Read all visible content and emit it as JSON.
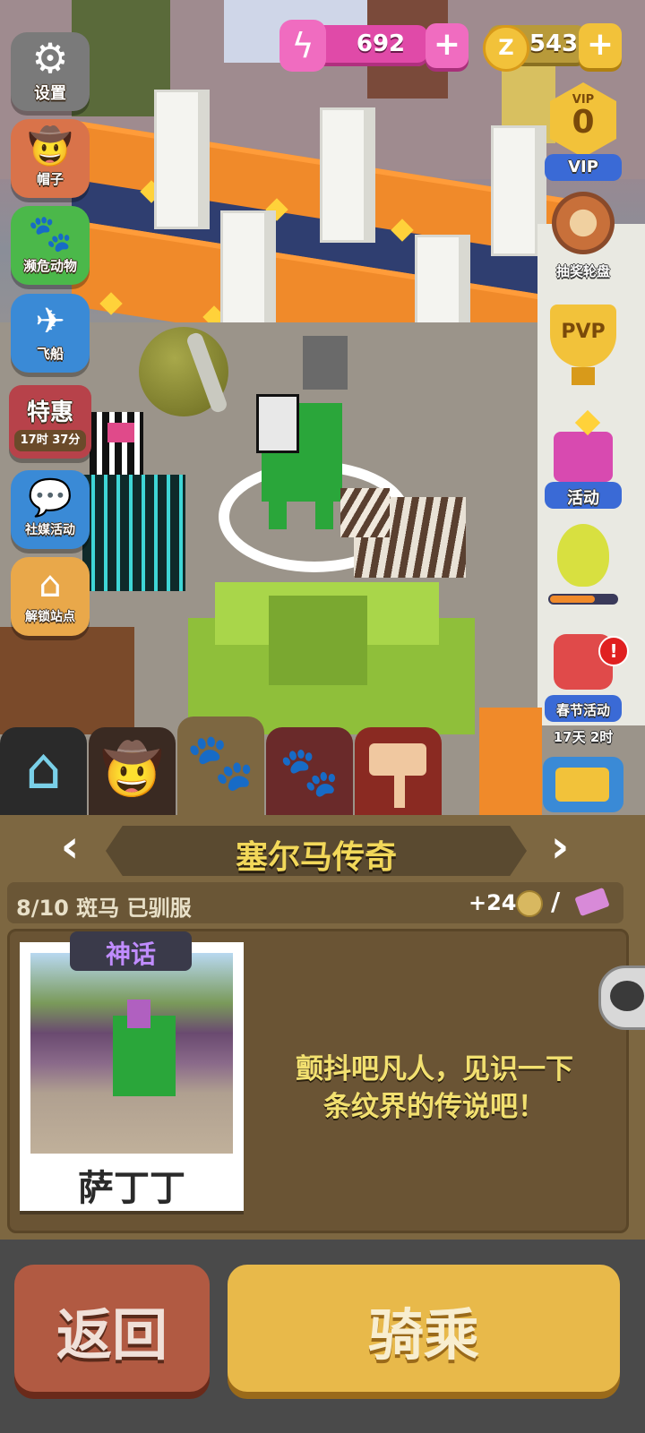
{
  "top_bar": {
    "settings_label": "设置",
    "energy_value": "692",
    "coin_value": "543",
    "plus": "+",
    "coin_symbol": "Z"
  },
  "left_menu": {
    "hat_label": "帽子",
    "unlock_animal_label": "濒危动物",
    "airship_label": "飞船",
    "special_label": "特惠",
    "special_timer": "17时 37分",
    "social_label": "社媒活动",
    "unlock_station_label": "解锁站点"
  },
  "right_menu": {
    "vip_level": "0",
    "vip_badge": "VIP",
    "vip_label": "VIP",
    "lottery_label": "抽奖轮盘",
    "pvp_label": "PVP",
    "event_label": "活动",
    "festival_label": "春节活动",
    "festival_timer": "17天 2时",
    "alert": "!"
  },
  "panel": {
    "title": "塞尔马传奇",
    "progress_text": "8/10 斑马 已驯服",
    "reward_text": "+24",
    "divider": "/",
    "card": {
      "rarity": "神话",
      "name": "萨丁丁"
    },
    "description_line1": "颤抖吧凡人，见识一下",
    "description_line2": "条纹界的传说吧！"
  },
  "buttons": {
    "back": "返回",
    "ride": "骑乘"
  },
  "colors": {
    "energy_pink": "#e04aa8",
    "coin_gold": "#f2c23a",
    "ride_yellow": "#e8b94a",
    "back_red": "#b15a42",
    "panel_brown": "#7d6741",
    "mythic_purple": "#c08cff"
  }
}
